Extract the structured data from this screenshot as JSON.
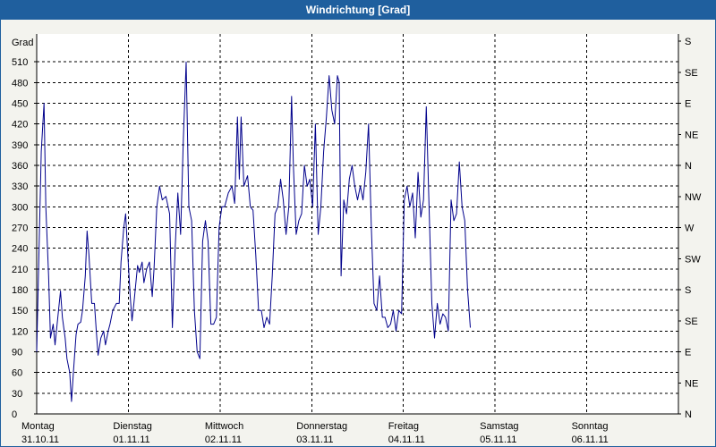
{
  "window": {
    "title": "Windrichtung [Grad]"
  },
  "chart_data": {
    "type": "line",
    "title": "Windrichtung [Grad]",
    "ylabel": "Grad",
    "ylim": [
      0,
      540
    ],
    "yticks": [
      0,
      30,
      60,
      90,
      120,
      150,
      180,
      210,
      240,
      270,
      300,
      330,
      360,
      390,
      420,
      450,
      480,
      510
    ],
    "xlim": [
      0,
      7
    ],
    "x_days": [
      {
        "day": "Montag",
        "date": "31.10.11"
      },
      {
        "day": "Dienstag",
        "date": "01.11.11"
      },
      {
        "day": "Mittwoch",
        "date": "02.11.11"
      },
      {
        "day": "Donnerstag",
        "date": "03.11.11"
      },
      {
        "day": "Freitag",
        "date": "04.11.11"
      },
      {
        "day": "Samstag",
        "date": "05.11.11"
      },
      {
        "day": "Sonntag",
        "date": "06.11.11"
      }
    ],
    "right_axis_labels": [
      {
        "value": 0,
        "label": "N"
      },
      {
        "value": 45,
        "label": "NE"
      },
      {
        "value": 90,
        "label": "E"
      },
      {
        "value": 135,
        "label": "SE"
      },
      {
        "value": 180,
        "label": "S"
      },
      {
        "value": 225,
        "label": "SW"
      },
      {
        "value": 270,
        "label": "W"
      },
      {
        "value": 315,
        "label": "NW"
      },
      {
        "value": 360,
        "label": "N"
      },
      {
        "value": 405,
        "label": "NE"
      },
      {
        "value": 450,
        "label": "E"
      },
      {
        "value": 495,
        "label": "SE"
      },
      {
        "value": 540,
        "label": "S"
      }
    ],
    "grid": true,
    "series": [
      {
        "color": "#00008b",
        "points": [
          [
            0.0,
            90
          ],
          [
            0.05,
            380
          ],
          [
            0.08,
            450
          ],
          [
            0.1,
            300
          ],
          [
            0.13,
            200
          ],
          [
            0.15,
            110
          ],
          [
            0.18,
            130
          ],
          [
            0.2,
            100
          ],
          [
            0.23,
            140
          ],
          [
            0.26,
            178
          ],
          [
            0.28,
            140
          ],
          [
            0.31,
            110
          ],
          [
            0.33,
            80
          ],
          [
            0.36,
            60
          ],
          [
            0.38,
            18
          ],
          [
            0.4,
            60
          ],
          [
            0.43,
            115
          ],
          [
            0.45,
            130
          ],
          [
            0.48,
            133
          ],
          [
            0.5,
            150
          ],
          [
            0.53,
            200
          ],
          [
            0.55,
            265
          ],
          [
            0.57,
            230
          ],
          [
            0.6,
            160
          ],
          [
            0.63,
            160
          ],
          [
            0.65,
            120
          ],
          [
            0.67,
            85
          ],
          [
            0.7,
            110
          ],
          [
            0.73,
            120
          ],
          [
            0.75,
            100
          ],
          [
            0.78,
            120
          ],
          [
            0.8,
            130
          ],
          [
            0.83,
            150
          ],
          [
            0.87,
            160
          ],
          [
            0.9,
            160
          ],
          [
            0.92,
            220
          ],
          [
            0.95,
            270
          ],
          [
            0.97,
            290
          ],
          [
            0.99,
            240
          ],
          [
            1.02,
            170
          ],
          [
            1.04,
            135
          ],
          [
            1.06,
            160
          ],
          [
            1.1,
            215
          ],
          [
            1.12,
            205
          ],
          [
            1.15,
            220
          ],
          [
            1.17,
            190
          ],
          [
            1.2,
            210
          ],
          [
            1.23,
            220
          ],
          [
            1.26,
            170
          ],
          [
            1.28,
            210
          ],
          [
            1.31,
            300
          ],
          [
            1.34,
            330
          ],
          [
            1.37,
            310
          ],
          [
            1.41,
            315
          ],
          [
            1.45,
            290
          ],
          [
            1.48,
            125
          ],
          [
            1.51,
            240
          ],
          [
            1.54,
            320
          ],
          [
            1.57,
            260
          ],
          [
            1.6,
            400
          ],
          [
            1.63,
            510
          ],
          [
            1.66,
            300
          ],
          [
            1.69,
            280
          ],
          [
            1.72,
            150
          ],
          [
            1.75,
            90
          ],
          [
            1.78,
            80
          ],
          [
            1.81,
            250
          ],
          [
            1.84,
            280
          ],
          [
            1.87,
            250
          ],
          [
            1.9,
            130
          ],
          [
            1.93,
            130
          ],
          [
            1.96,
            140
          ],
          [
            1.99,
            270
          ],
          [
            2.02,
            300
          ],
          [
            2.05,
            300
          ],
          [
            2.09,
            320
          ],
          [
            2.13,
            330
          ],
          [
            2.16,
            305
          ],
          [
            2.19,
            430
          ],
          [
            2.21,
            340
          ],
          [
            2.23,
            430
          ],
          [
            2.26,
            330
          ],
          [
            2.3,
            345
          ],
          [
            2.33,
            300
          ],
          [
            2.36,
            295
          ],
          [
            2.39,
            230
          ],
          [
            2.42,
            150
          ],
          [
            2.45,
            150
          ],
          [
            2.48,
            125
          ],
          [
            2.51,
            140
          ],
          [
            2.54,
            130
          ],
          [
            2.57,
            200
          ],
          [
            2.6,
            290
          ],
          [
            2.63,
            300
          ],
          [
            2.66,
            340
          ],
          [
            2.69,
            310
          ],
          [
            2.72,
            260
          ],
          [
            2.75,
            300
          ],
          [
            2.78,
            460
          ],
          [
            2.8,
            360
          ],
          [
            2.83,
            260
          ],
          [
            2.86,
            280
          ],
          [
            2.89,
            290
          ],
          [
            2.92,
            360
          ],
          [
            2.95,
            330
          ],
          [
            2.98,
            340
          ],
          [
            3.01,
            300
          ],
          [
            3.04,
            420
          ],
          [
            3.07,
            260
          ],
          [
            3.1,
            300
          ],
          [
            3.13,
            380
          ],
          [
            3.16,
            430
          ],
          [
            3.19,
            490
          ],
          [
            3.22,
            440
          ],
          [
            3.25,
            420
          ],
          [
            3.28,
            490
          ],
          [
            3.3,
            480
          ],
          [
            3.32,
            200
          ],
          [
            3.35,
            310
          ],
          [
            3.38,
            290
          ],
          [
            3.41,
            340
          ],
          [
            3.44,
            360
          ],
          [
            3.47,
            330
          ],
          [
            3.5,
            310
          ],
          [
            3.53,
            330
          ],
          [
            3.56,
            310
          ],
          [
            3.59,
            350
          ],
          [
            3.62,
            420
          ],
          [
            3.65,
            270
          ],
          [
            3.68,
            160
          ],
          [
            3.71,
            150
          ],
          [
            3.74,
            200
          ],
          [
            3.77,
            140
          ],
          [
            3.8,
            140
          ],
          [
            3.83,
            125
          ],
          [
            3.86,
            130
          ],
          [
            3.89,
            150
          ],
          [
            3.92,
            120
          ],
          [
            3.95,
            150
          ],
          [
            3.98,
            145
          ],
          [
            4.01,
            310
          ],
          [
            4.04,
            330
          ],
          [
            4.07,
            300
          ],
          [
            4.1,
            320
          ],
          [
            4.13,
            255
          ],
          [
            4.16,
            350
          ],
          [
            4.19,
            285
          ],
          [
            4.22,
            310
          ],
          [
            4.25,
            445
          ],
          [
            4.28,
            300
          ],
          [
            4.31,
            160
          ],
          [
            4.34,
            110
          ],
          [
            4.37,
            160
          ],
          [
            4.4,
            130
          ],
          [
            4.43,
            145
          ],
          [
            4.46,
            140
          ],
          [
            4.49,
            120
          ],
          [
            4.52,
            310
          ],
          [
            4.55,
            280
          ],
          [
            4.58,
            290
          ],
          [
            4.61,
            365
          ],
          [
            4.64,
            300
          ],
          [
            4.67,
            280
          ],
          [
            4.7,
            180
          ],
          [
            4.73,
            125
          ]
        ]
      }
    ]
  }
}
